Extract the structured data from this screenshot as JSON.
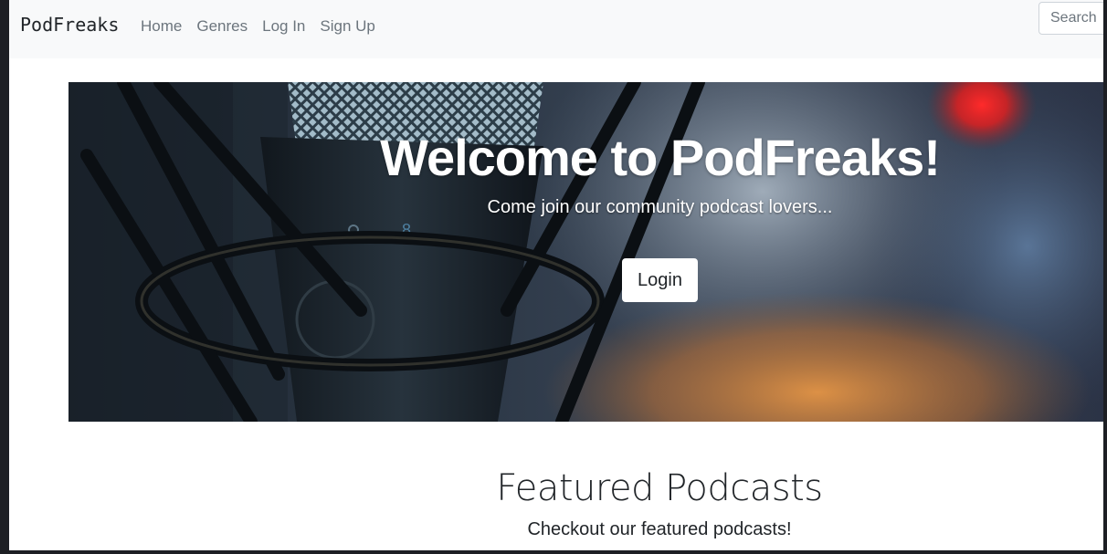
{
  "navbar": {
    "brand": "PodFreaks",
    "links": [
      "Home",
      "Genres",
      "Log In",
      "Sign Up"
    ],
    "search": {
      "placeholder": "Search"
    }
  },
  "hero": {
    "title": "Welcome to PodFreaks!",
    "subtitle": "Come join our community podcast lovers...",
    "login_label": "Login"
  },
  "featured": {
    "title": "Featured Podcasts",
    "subtitle": "Checkout our featured podcasts!"
  }
}
